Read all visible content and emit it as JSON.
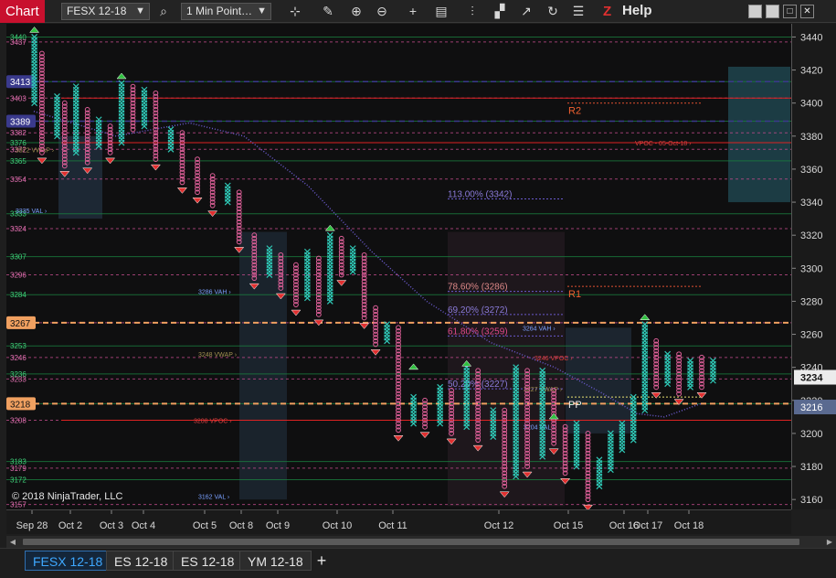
{
  "toolbar": {
    "chart_label": "Chart",
    "instrument": "FESX 12-18",
    "period": "1 Min Point…",
    "help_label": "Help",
    "z_label": "Z",
    "icons": [
      "search-icon",
      "crosshair-icon",
      "draw-icon",
      "zoom-in-icon",
      "zoom-out-icon",
      "cross-icon",
      "data-box-icon",
      "bar-type-icon",
      "strategy-icon",
      "indicator-icon",
      "refresh-icon",
      "properties-icon"
    ]
  },
  "window": {
    "minimize": "▁",
    "restore": "❐",
    "maximize": "□",
    "close": "✕"
  },
  "copyright": "© 2018 NinjaTrader, LLC",
  "tabs": [
    {
      "label": "FESX 12-18",
      "active": true
    },
    {
      "label": "ES 12-18",
      "active": false
    },
    {
      "label": "ES 12-18",
      "active": false
    },
    {
      "label": "YM 12-18",
      "active": false
    }
  ],
  "tab_add": "+",
  "colors": {
    "up": "#2fc9b7",
    "down": "#e0609a",
    "level_green": "#1a7f3f",
    "level_pink": "#c04a8a",
    "vpoc_red": "#d22",
    "pp_orange": "#f0a060",
    "fib": "#6a5acd",
    "price_box": "#ececec"
  },
  "chart_data": {
    "type": "point-and-figure",
    "y_axis": {
      "ticks": [
        3440,
        3420,
        3400,
        3380,
        3360,
        3340,
        3320,
        3300,
        3280,
        3260,
        3240,
        3220,
        3200,
        3180,
        3160
      ],
      "ylim": [
        3154,
        3448
      ],
      "current_price": 3234,
      "pp_marker": 3216
    },
    "x_axis": {
      "labels": [
        "Sep 28",
        "Oct 2",
        "Oct 3",
        "Oct 4",
        "Oct 5",
        "Oct 8",
        "Oct 9",
        "Oct 10",
        "Oct 11",
        "Oct 12",
        "Oct 15",
        "Oct 16",
        "Oct 17",
        "Oct 18"
      ]
    },
    "fib_levels": [
      {
        "label": "113.00% (3342)",
        "price": 3342
      },
      {
        "label": "78.60% (3286)",
        "price": 3286
      },
      {
        "label": "69.20% (3272)",
        "price": 3272
      },
      {
        "label": "61.80% (3259)",
        "price": 3259
      },
      {
        "label": "50.20% (3227)",
        "price": 3227
      }
    ],
    "pivots": [
      {
        "label": "R2",
        "price": 3400
      },
      {
        "label": "R1",
        "price": 3289
      },
      {
        "label": "PP",
        "price": 3222
      }
    ],
    "price_levels": [
      {
        "label": "3440",
        "price": 3440
      },
      {
        "label": "3437",
        "price": 3437
      },
      {
        "label": "3413",
        "price": 3413
      },
      {
        "label": "3403",
        "price": 3403
      },
      {
        "label": "3389",
        "price": 3389
      },
      {
        "label": "3382",
        "price": 3382
      },
      {
        "label": "3376",
        "price": 3376
      },
      {
        "label": "3372",
        "price": 3372
      },
      {
        "label": "3365",
        "price": 3365
      },
      {
        "label": "3354",
        "price": 3354
      },
      {
        "label": "3333",
        "price": 3333
      },
      {
        "label": "3324",
        "price": 3324
      },
      {
        "label": "3307",
        "price": 3307
      },
      {
        "label": "3296",
        "price": 3296
      },
      {
        "label": "3284",
        "price": 3284
      },
      {
        "label": "3267",
        "price": 3267
      },
      {
        "label": "3253",
        "price": 3253
      },
      {
        "label": "3246",
        "price": 3246
      },
      {
        "label": "3236",
        "price": 3236
      },
      {
        "label": "3233",
        "price": 3233
      },
      {
        "label": "3218",
        "price": 3218
      },
      {
        "label": "3208",
        "price": 3208
      },
      {
        "label": "3183",
        "price": 3183
      },
      {
        "label": "3179",
        "price": 3179
      },
      {
        "label": "3172",
        "price": 3172
      },
      {
        "label": "3157",
        "price": 3157
      }
    ],
    "boxed_levels": [
      {
        "label": "3413",
        "price": 3413,
        "color": "#3a3a8c"
      },
      {
        "label": "3389",
        "price": 3389,
        "color": "#3a3a8c"
      },
      {
        "label": "3267",
        "price": 3267,
        "color": "#f0a060"
      },
      {
        "label": "3218",
        "price": 3218,
        "color": "#f0a060"
      }
    ],
    "annotations": [
      {
        "label": "3335 VAL",
        "price": 3335
      },
      {
        "label": "3286 VAH",
        "price": 3286
      },
      {
        "label": "3264 VAH",
        "price": 3264
      },
      {
        "label": "3204 VAL",
        "price": 3204
      },
      {
        "label": "3162 VAL",
        "price": 3162
      },
      {
        "label": "3208 VPOC",
        "price": 3208
      },
      {
        "label": "3246 VPOC",
        "price": 3246
      },
      {
        "label": "3248 VWAP",
        "price": 3248
      },
      {
        "label": "3372 VWAP",
        "price": 3372
      },
      {
        "label": "3227 VWAP",
        "price": 3227
      },
      {
        "label": "VPOC - 05-Oct-18",
        "price": 3376
      }
    ],
    "columns": [
      {
        "x": 0.02,
        "type": "X",
        "low": 3400,
        "high": 3440
      },
      {
        "x": 0.03,
        "type": "O",
        "low": 3370,
        "high": 3430
      },
      {
        "x": 0.05,
        "type": "X",
        "low": 3380,
        "high": 3405
      },
      {
        "x": 0.06,
        "type": "O",
        "low": 3362,
        "high": 3400
      },
      {
        "x": 0.075,
        "type": "X",
        "low": 3370,
        "high": 3410
      },
      {
        "x": 0.09,
        "type": "O",
        "low": 3364,
        "high": 3396
      },
      {
        "x": 0.105,
        "type": "X",
        "low": 3374,
        "high": 3390
      },
      {
        "x": 0.12,
        "type": "O",
        "low": 3370,
        "high": 3386
      },
      {
        "x": 0.135,
        "type": "X",
        "low": 3376,
        "high": 3412
      },
      {
        "x": 0.15,
        "type": "O",
        "low": 3384,
        "high": 3410
      },
      {
        "x": 0.165,
        "type": "X",
        "low": 3386,
        "high": 3408
      },
      {
        "x": 0.18,
        "type": "O",
        "low": 3366,
        "high": 3406
      },
      {
        "x": 0.2,
        "type": "X",
        "low": 3372,
        "high": 3384
      },
      {
        "x": 0.215,
        "type": "O",
        "low": 3352,
        "high": 3382
      },
      {
        "x": 0.235,
        "type": "O",
        "low": 3346,
        "high": 3366
      },
      {
        "x": 0.255,
        "type": "O",
        "low": 3338,
        "high": 3356
      },
      {
        "x": 0.275,
        "type": "X",
        "low": 3340,
        "high": 3350
      },
      {
        "x": 0.29,
        "type": "O",
        "low": 3316,
        "high": 3346
      },
      {
        "x": 0.31,
        "type": "O",
        "low": 3294,
        "high": 3320
      },
      {
        "x": 0.33,
        "type": "X",
        "low": 3296,
        "high": 3312
      },
      {
        "x": 0.345,
        "type": "O",
        "low": 3288,
        "high": 3308
      },
      {
        "x": 0.365,
        "type": "O",
        "low": 3278,
        "high": 3302
      },
      {
        "x": 0.38,
        "type": "X",
        "low": 3282,
        "high": 3310
      },
      {
        "x": 0.395,
        "type": "O",
        "low": 3272,
        "high": 3306
      },
      {
        "x": 0.41,
        "type": "X",
        "low": 3280,
        "high": 3320
      },
      {
        "x": 0.425,
        "type": "O",
        "low": 3296,
        "high": 3318
      },
      {
        "x": 0.44,
        "type": "X",
        "low": 3298,
        "high": 3312
      },
      {
        "x": 0.455,
        "type": "O",
        "low": 3270,
        "high": 3308
      },
      {
        "x": 0.47,
        "type": "O",
        "low": 3254,
        "high": 3276
      },
      {
        "x": 0.485,
        "type": "X",
        "low": 3256,
        "high": 3266
      },
      {
        "x": 0.5,
        "type": "O",
        "low": 3202,
        "high": 3264
      },
      {
        "x": 0.52,
        "type": "X",
        "low": 3206,
        "high": 3222
      },
      {
        "x": 0.535,
        "type": "O",
        "low": 3204,
        "high": 3220
      },
      {
        "x": 0.555,
        "type": "X",
        "low": 3206,
        "high": 3228
      },
      {
        "x": 0.57,
        "type": "O",
        "low": 3200,
        "high": 3226
      },
      {
        "x": 0.59,
        "type": "X",
        "low": 3204,
        "high": 3240
      },
      {
        "x": 0.605,
        "type": "O",
        "low": 3196,
        "high": 3238
      },
      {
        "x": 0.625,
        "type": "X",
        "low": 3198,
        "high": 3214
      },
      {
        "x": 0.64,
        "type": "O",
        "low": 3168,
        "high": 3214
      },
      {
        "x": 0.655,
        "type": "X",
        "low": 3174,
        "high": 3240
      },
      {
        "x": 0.67,
        "type": "O",
        "low": 3180,
        "high": 3238
      },
      {
        "x": 0.69,
        "type": "X",
        "low": 3186,
        "high": 3238
      },
      {
        "x": 0.705,
        "type": "O",
        "low": 3194,
        "high": 3226
      },
      {
        "x": 0.72,
        "type": "O",
        "low": 3176,
        "high": 3204
      },
      {
        "x": 0.735,
        "type": "X",
        "low": 3180,
        "high": 3206
      },
      {
        "x": 0.75,
        "type": "O",
        "low": 3160,
        "high": 3200
      },
      {
        "x": 0.765,
        "type": "X",
        "low": 3168,
        "high": 3184
      },
      {
        "x": 0.78,
        "type": "X",
        "low": 3178,
        "high": 3200
      },
      {
        "x": 0.795,
        "type": "X",
        "low": 3190,
        "high": 3206
      },
      {
        "x": 0.81,
        "type": "X",
        "low": 3196,
        "high": 3222
      },
      {
        "x": 0.825,
        "type": "X",
        "low": 3214,
        "high": 3266
      },
      {
        "x": 0.84,
        "type": "O",
        "low": 3228,
        "high": 3256
      },
      {
        "x": 0.855,
        "type": "X",
        "low": 3230,
        "high": 3248
      },
      {
        "x": 0.87,
        "type": "O",
        "low": 3224,
        "high": 3248
      },
      {
        "x": 0.885,
        "type": "X",
        "low": 3228,
        "high": 3244
      },
      {
        "x": 0.9,
        "type": "O",
        "low": 3228,
        "high": 3246
      },
      {
        "x": 0.915,
        "type": "X",
        "low": 3232,
        "high": 3244
      }
    ]
  }
}
